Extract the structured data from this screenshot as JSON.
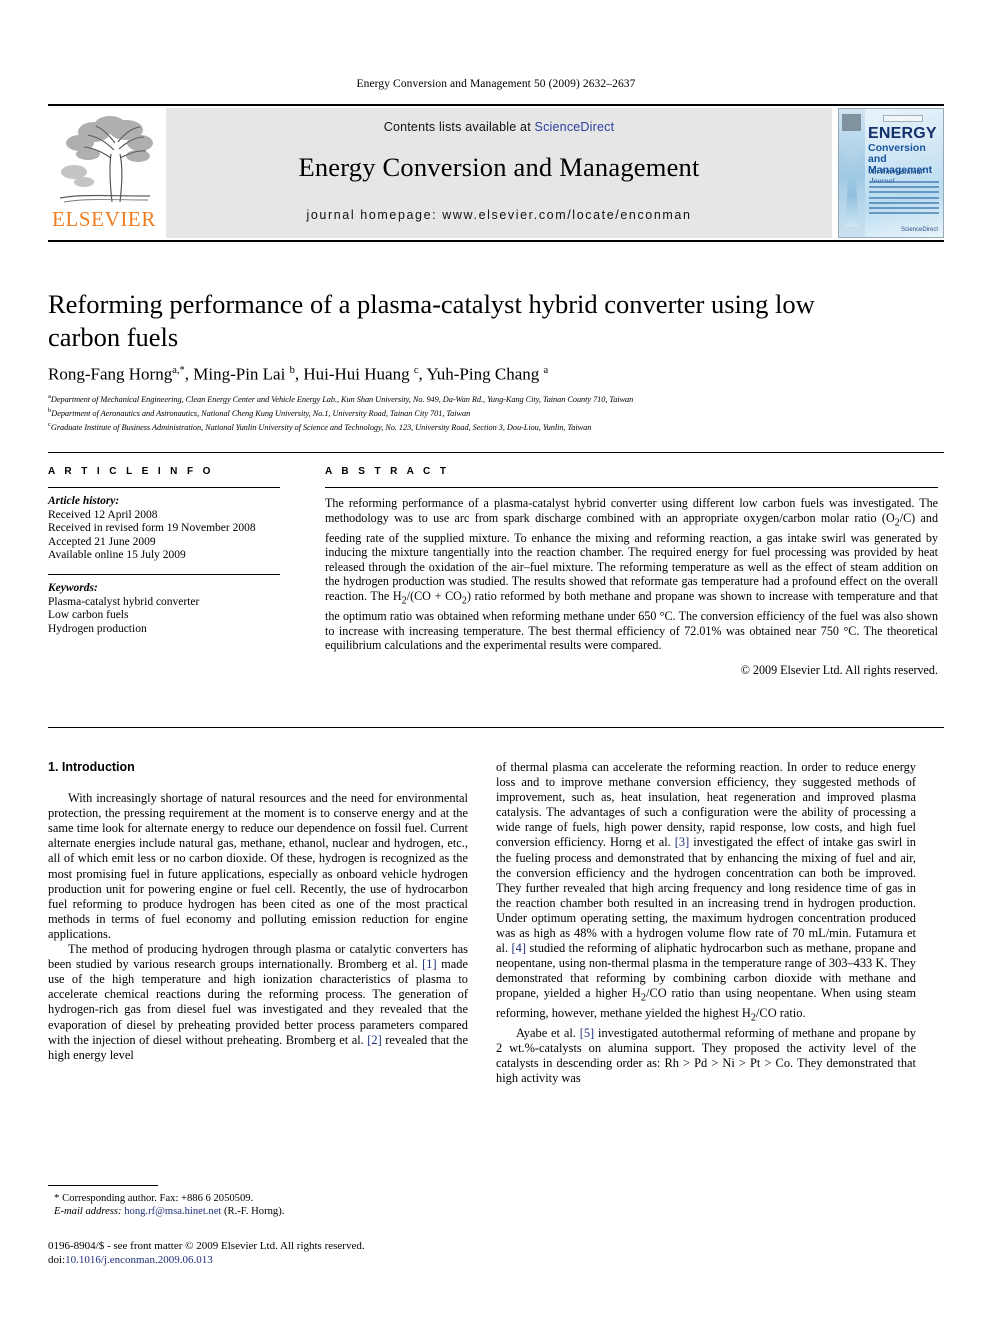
{
  "running_head": "Energy Conversion and Management 50 (2009) 2632–2637",
  "masthead": {
    "contents_prefix": "Contents lists available at ",
    "sciencedirect": "ScienceDirect",
    "journal_title": "Energy Conversion and Management",
    "homepage": "journal homepage: www.elsevier.com/locate/enconman",
    "publisher_wordmark": "ELSEVIER",
    "publisher_color": "#f07c1f",
    "link_color": "#2b3fa0",
    "band_color": "#e6e6e6",
    "cover": {
      "title": "ENERGY",
      "subtitle": "Conversion and Management",
      "tagline": "An International Journal",
      "brand": "ScienceDirect"
    }
  },
  "article": {
    "title": "Reforming performance of a plasma-catalyst hybrid converter using low carbon fuels",
    "authors_html": "Rong-Fang Horng<sup>a,*</sup>, Ming-Pin Lai <sup>b</sup>, Hui-Hui Huang <sup>c</sup>, Yuh-Ping Chang <sup>a</sup>",
    "affiliations": [
      "Department of Mechanical Engineering, Clean Energy Center and Vehicle Energy Lab., Kun Shan University, No. 949, Da-Wan Rd., Yung-Kang City, Tainan County 710, Taiwan",
      "Department of Aeronautics and Astronautics, National Cheng Kung University, No.1, University Road, Tainan City 701, Taiwan",
      "Graduate Institute of Business Administration, National Yunlin University of Science and Technology, No. 123, University Road, Section 3, Dou-Liou, Yunlin, Taiwan"
    ],
    "affiliation_marks": [
      "a",
      "b",
      "c"
    ]
  },
  "article_info": {
    "heading": "A R T I C L E   I N F O",
    "history_label": "Article history:",
    "history": [
      "Received 12 April 2008",
      "Received in revised form 19 November 2008",
      "Accepted 21 June 2009",
      "Available online 15 July 2009"
    ],
    "keywords_label": "Keywords:",
    "keywords": [
      "Plasma-catalyst hybrid converter",
      "Low carbon fuels",
      "Hydrogen production"
    ]
  },
  "abstract": {
    "heading": "A B S T R A C T",
    "text": "The reforming performance of a plasma-catalyst hybrid converter using different low carbon fuels was investigated. The methodology was to use arc from spark discharge combined with an appropriate oxygen/carbon molar ratio (O2/C) and feeding rate of the supplied mixture. To enhance the mixing and reforming reaction, a gas intake swirl was generated by inducing the mixture tangentially into the reaction chamber. The required energy for fuel processing was provided by heat released through the oxidation of the air–fuel mixture. The reforming temperature as well as the effect of steam addition on the hydrogen production was studied. The results showed that reformate gas temperature had a profound effect on the overall reaction. The H2/(CO + CO2) ratio reformed by both methane and propane was shown to increase with temperature and that the optimum ratio was obtained when reforming methane under 650 °C. The conversion efficiency of the fuel was also shown to increase with increasing temperature. The best thermal efficiency of 72.01% was obtained near 750 °C. The theoretical equilibrium calculations and the experimental results were compared.",
    "copyright": "© 2009 Elsevier Ltd. All rights reserved."
  },
  "introduction": {
    "heading": "1. Introduction",
    "left_paragraphs": [
      "With increasingly shortage of natural resources and the need for environmental protection, the pressing requirement at the moment is to conserve energy and at the same time look for alternate energy to reduce our dependence on fossil fuel. Current alternate energies include natural gas, methane, ethanol, nuclear and hydrogen, etc., all of which emit less or no carbon dioxide. Of these, hydrogen is recognized as the most promising fuel in future applications, especially as onboard vehicle hydrogen production unit for powering engine or fuel cell. Recently, the use of hydrocarbon fuel reforming to produce hydrogen has been cited as one of the most practical methods in terms of fuel economy and polluting emission reduction for engine applications."
    ],
    "left_paragraph2_parts": [
      "The method of producing hydrogen through plasma or catalytic converters has been studied by various research groups internationally. Bromberg et al. ",
      "[1]",
      " made use of the high temperature and high ionization characteristics of plasma to accelerate chemical reactions during the reforming process. The generation of hydrogen-rich gas from diesel fuel was investigated and they revealed that the evaporation of diesel by preheating provided better process parameters compared with the injection of diesel without preheating. Bromberg et al. ",
      "[2]",
      " revealed that the high energy level"
    ],
    "right_paragraph1_parts": [
      "of thermal plasma can accelerate the reforming reaction. In order to reduce energy loss and to improve methane conversion efficiency, they suggested methods of improvement, such as, heat insulation, heat regeneration and improved plasma catalysis. The advantages of such a configuration were the ability of processing a wide range of fuels, high power density, rapid response, low costs, and high fuel conversion efficiency. Horng et al. ",
      "[3]",
      " investigated the effect of intake gas swirl in the fueling process and demonstrated that by enhancing the mixing of fuel and air, the conversion efficiency and the hydrogen concentration can both be improved. They further revealed that high arcing frequency and long residence time of gas in the reaction chamber both resulted in an increasing trend in hydrogen production. Under optimum operating setting, the maximum hydrogen concentration produced was as high as 48% with a hydrogen volume flow rate of 70 mL/min. Futamura et al. ",
      "[4]",
      " studied the reforming of aliphatic hydrocarbon such as methane, propane and neopentane, using non-thermal plasma in the temperature range of 303–433 K. They demonstrated that reforming by combining carbon dioxide with methane and propane, yielded a higher H2/CO ratio than using neopentane. When using steam reforming, however, methane yielded the highest H2/CO ratio."
    ],
    "right_paragraph2_parts": [
      "Ayabe et al. ",
      "[5]",
      " investigated autothermal reforming of methane and propane by 2 wt.%-catalysts on alumina support. They proposed the activity level of the catalysts in descending order as: Rh > Pd > Ni > Pt > Co. They demonstrated that high activity was"
    ]
  },
  "footnote": {
    "star": "*",
    "corresponding": "Corresponding author. Fax: +886 6 2050509.",
    "email_label": "E-mail address:",
    "email": "hong.rf@msa.hinet.net",
    "email_owner": "(R.-F. Horng)."
  },
  "footer": {
    "issn_line": "0196-8904/$ - see front matter © 2009 Elsevier Ltd. All rights reserved.",
    "doi_label": "doi:",
    "doi": "10.1016/j.enconman.2009.06.013"
  }
}
